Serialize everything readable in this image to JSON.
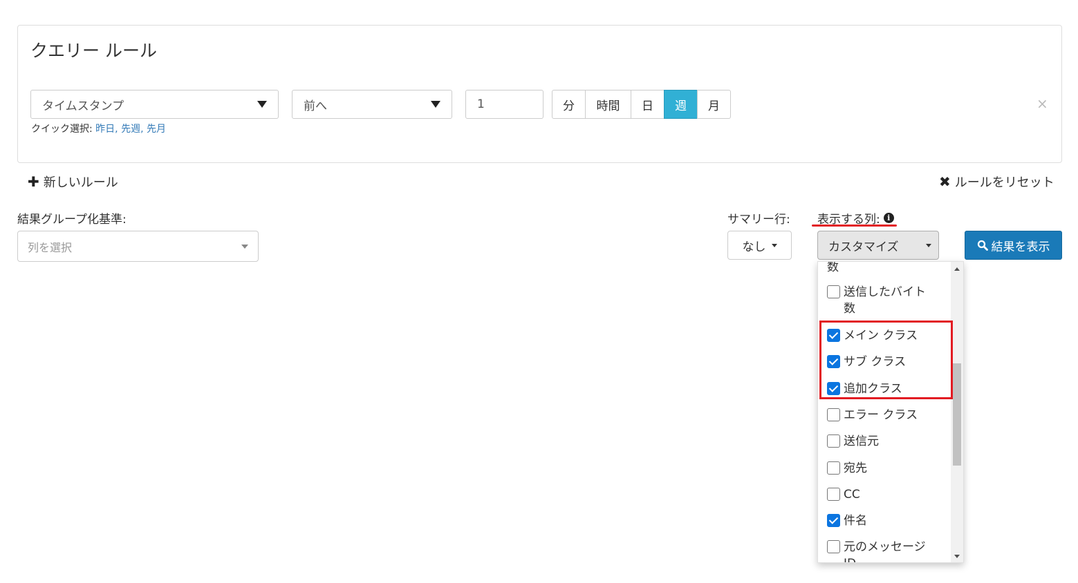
{
  "panel": {
    "title": "クエリー ルール",
    "field_select": "タイムスタンプ",
    "direction_select": "前へ",
    "amount_value": "1",
    "units": [
      {
        "label": "分",
        "active": false
      },
      {
        "label": "時間",
        "active": false
      },
      {
        "label": "日",
        "active": false
      },
      {
        "label": "週",
        "active": true
      },
      {
        "label": "月",
        "active": false
      }
    ],
    "quick_label": "クイック選択:",
    "quick_links": [
      "昨日",
      "先週",
      "先月"
    ],
    "remove_glyph": "×"
  },
  "actions": {
    "new_rule_icon": "✚",
    "new_rule": "新しいルール",
    "reset_icon": "✖",
    "reset_rules": "ルールをリセット"
  },
  "group_by": {
    "label": "結果グループ化基準:",
    "placeholder": "列を選択"
  },
  "summary": {
    "label": "サマリー行:",
    "value": "なし"
  },
  "columns": {
    "label": "表示する列:",
    "info_glyph": "i",
    "button_label": "カスタマイズ",
    "items": [
      {
        "label": "数",
        "checked": null,
        "partial": true
      },
      {
        "label": "送信したバイト数",
        "checked": false
      },
      {
        "label": "メイン クラス",
        "checked": true
      },
      {
        "label": "サブ クラス",
        "checked": true
      },
      {
        "label": "追加クラス",
        "checked": true
      },
      {
        "label": "エラー クラス",
        "checked": false
      },
      {
        "label": "送信元",
        "checked": false
      },
      {
        "label": "宛先",
        "checked": false
      },
      {
        "label": "CC",
        "checked": false
      },
      {
        "label": "件名",
        "checked": true
      },
      {
        "label": "元のメッセージID",
        "checked": false
      }
    ]
  },
  "show_results": {
    "icon": "search-icon",
    "label": "結果を表示"
  },
  "colors": {
    "active_unit": "#31b0d5",
    "primary_button": "#1a7ab8",
    "link": "#337ab7",
    "highlight": "#e21b22",
    "checkbox": "#0b75e0"
  }
}
